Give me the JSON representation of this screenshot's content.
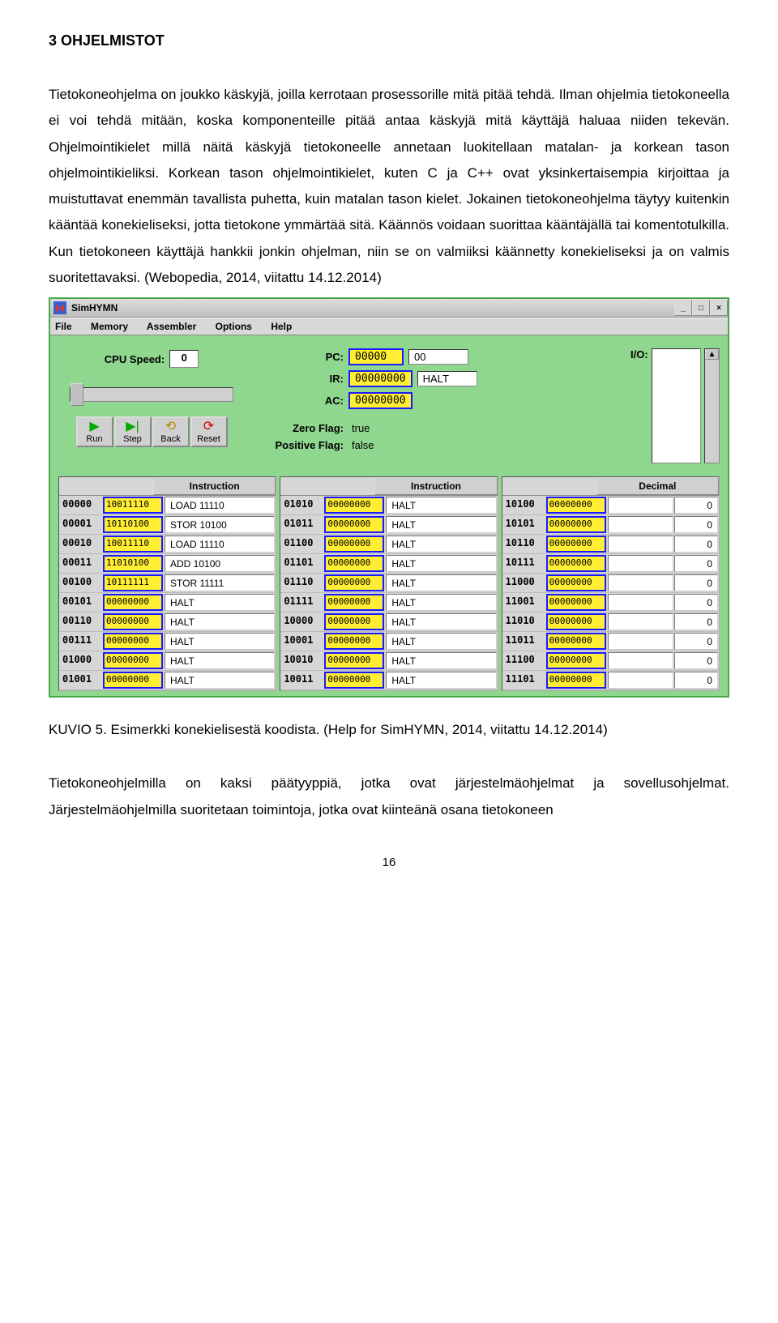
{
  "heading": "3    OHJELMISTOT",
  "paragraph1": "Tietokoneohjelma on joukko käskyjä, joilla kerrotaan prosessorille mitä pitää tehdä. Ilman ohjelmia tietokoneella ei voi tehdä mitään, koska komponenteille pitää antaa käskyjä mitä käyttäjä haluaa niiden tekevän. Ohjelmointikielet millä näitä käskyjä tietokoneelle annetaan luokitellaan matalan- ja korkean tason ohjelmointikieliksi. Korkean tason ohjelmointikielet, kuten C ja C++ ovat yksinkertaisempia kirjoittaa ja muistuttavat enemmän tavallista puhetta, kuin matalan tason kielet. Jokainen tietokoneohjelma täytyy kuitenkin kääntää konekieliseksi, jotta tietokone ymmärtää sitä. Käännös voidaan suorittaa kääntäjällä tai komentotulkilla. Kun tietokoneen käyttäjä hankkii jonkin ohjelman, niin se on valmiiksi käännetty konekieliseksi ja on valmis suoritettavaksi. (Webopedia, 2014, viitattu 14.12.2014)",
  "caption": "KUVIO 5. Esimerkki konekielisestä koodista. (Help for SimHYMN, 2014, viitattu 14.12.2014)",
  "paragraph2": "Tietokoneohjelmilla on kaksi päätyyppiä, jotka ovat järjestelmäohjelmat ja sovellusohjelmat. Järjestelmäohjelmilla suoritetaan toimintoja, jotka ovat kiinteänä osana tietokoneen",
  "page_number": "16",
  "sim": {
    "title": "SimHYMN",
    "menus": [
      "File",
      "Memory",
      "Assembler",
      "Options",
      "Help"
    ],
    "cpu_speed_label": "CPU Speed:",
    "cpu_speed_value": "0",
    "buttons": {
      "run": "Run",
      "step": "Step",
      "back": "Back",
      "reset": "Reset"
    },
    "regs": {
      "pc_label": "PC:",
      "pc_bin": "00000",
      "pc_dec": "00",
      "ir_label": "IR:",
      "ir_bin": "00000000",
      "ir_txt": "HALT",
      "ac_label": "AC:",
      "ac_bin": "00000000",
      "zero_label": "Zero Flag:",
      "zero_val": "true",
      "pos_label": "Positive Flag:",
      "pos_val": "false"
    },
    "io_label": "I/O:",
    "mem_headers": {
      "inst": "Instruction",
      "dec": "Decimal"
    },
    "mem_col1": [
      {
        "addr": "00000",
        "bin": "10011110",
        "inst": "LOAD 11110"
      },
      {
        "addr": "00001",
        "bin": "10110100",
        "inst": "STOR 10100"
      },
      {
        "addr": "00010",
        "bin": "10011110",
        "inst": "LOAD 11110"
      },
      {
        "addr": "00011",
        "bin": "11010100",
        "inst": "ADD 10100"
      },
      {
        "addr": "00100",
        "bin": "10111111",
        "inst": "STOR 11111"
      },
      {
        "addr": "00101",
        "bin": "00000000",
        "inst": "HALT"
      },
      {
        "addr": "00110",
        "bin": "00000000",
        "inst": "HALT"
      },
      {
        "addr": "00111",
        "bin": "00000000",
        "inst": "HALT"
      },
      {
        "addr": "01000",
        "bin": "00000000",
        "inst": "HALT"
      },
      {
        "addr": "01001",
        "bin": "00000000",
        "inst": "HALT"
      }
    ],
    "mem_col2": [
      {
        "addr": "01010",
        "bin": "00000000",
        "inst": "HALT"
      },
      {
        "addr": "01011",
        "bin": "00000000",
        "inst": "HALT"
      },
      {
        "addr": "01100",
        "bin": "00000000",
        "inst": "HALT"
      },
      {
        "addr": "01101",
        "bin": "00000000",
        "inst": "HALT"
      },
      {
        "addr": "01110",
        "bin": "00000000",
        "inst": "HALT"
      },
      {
        "addr": "01111",
        "bin": "00000000",
        "inst": "HALT"
      },
      {
        "addr": "10000",
        "bin": "00000000",
        "inst": "HALT"
      },
      {
        "addr": "10001",
        "bin": "00000000",
        "inst": "HALT"
      },
      {
        "addr": "10010",
        "bin": "00000000",
        "inst": "HALT"
      },
      {
        "addr": "10011",
        "bin": "00000000",
        "inst": "HALT"
      }
    ],
    "mem_col3": [
      {
        "addr": "10100",
        "bin": "00000000",
        "dec": "0"
      },
      {
        "addr": "10101",
        "bin": "00000000",
        "dec": "0"
      },
      {
        "addr": "10110",
        "bin": "00000000",
        "dec": "0"
      },
      {
        "addr": "10111",
        "bin": "00000000",
        "dec": "0"
      },
      {
        "addr": "11000",
        "bin": "00000000",
        "dec": "0"
      },
      {
        "addr": "11001",
        "bin": "00000000",
        "dec": "0"
      },
      {
        "addr": "11010",
        "bin": "00000000",
        "dec": "0"
      },
      {
        "addr": "11011",
        "bin": "00000000",
        "dec": "0"
      },
      {
        "addr": "11100",
        "bin": "00000000",
        "dec": "0"
      },
      {
        "addr": "11101",
        "bin": "00000000",
        "dec": "0"
      }
    ]
  }
}
